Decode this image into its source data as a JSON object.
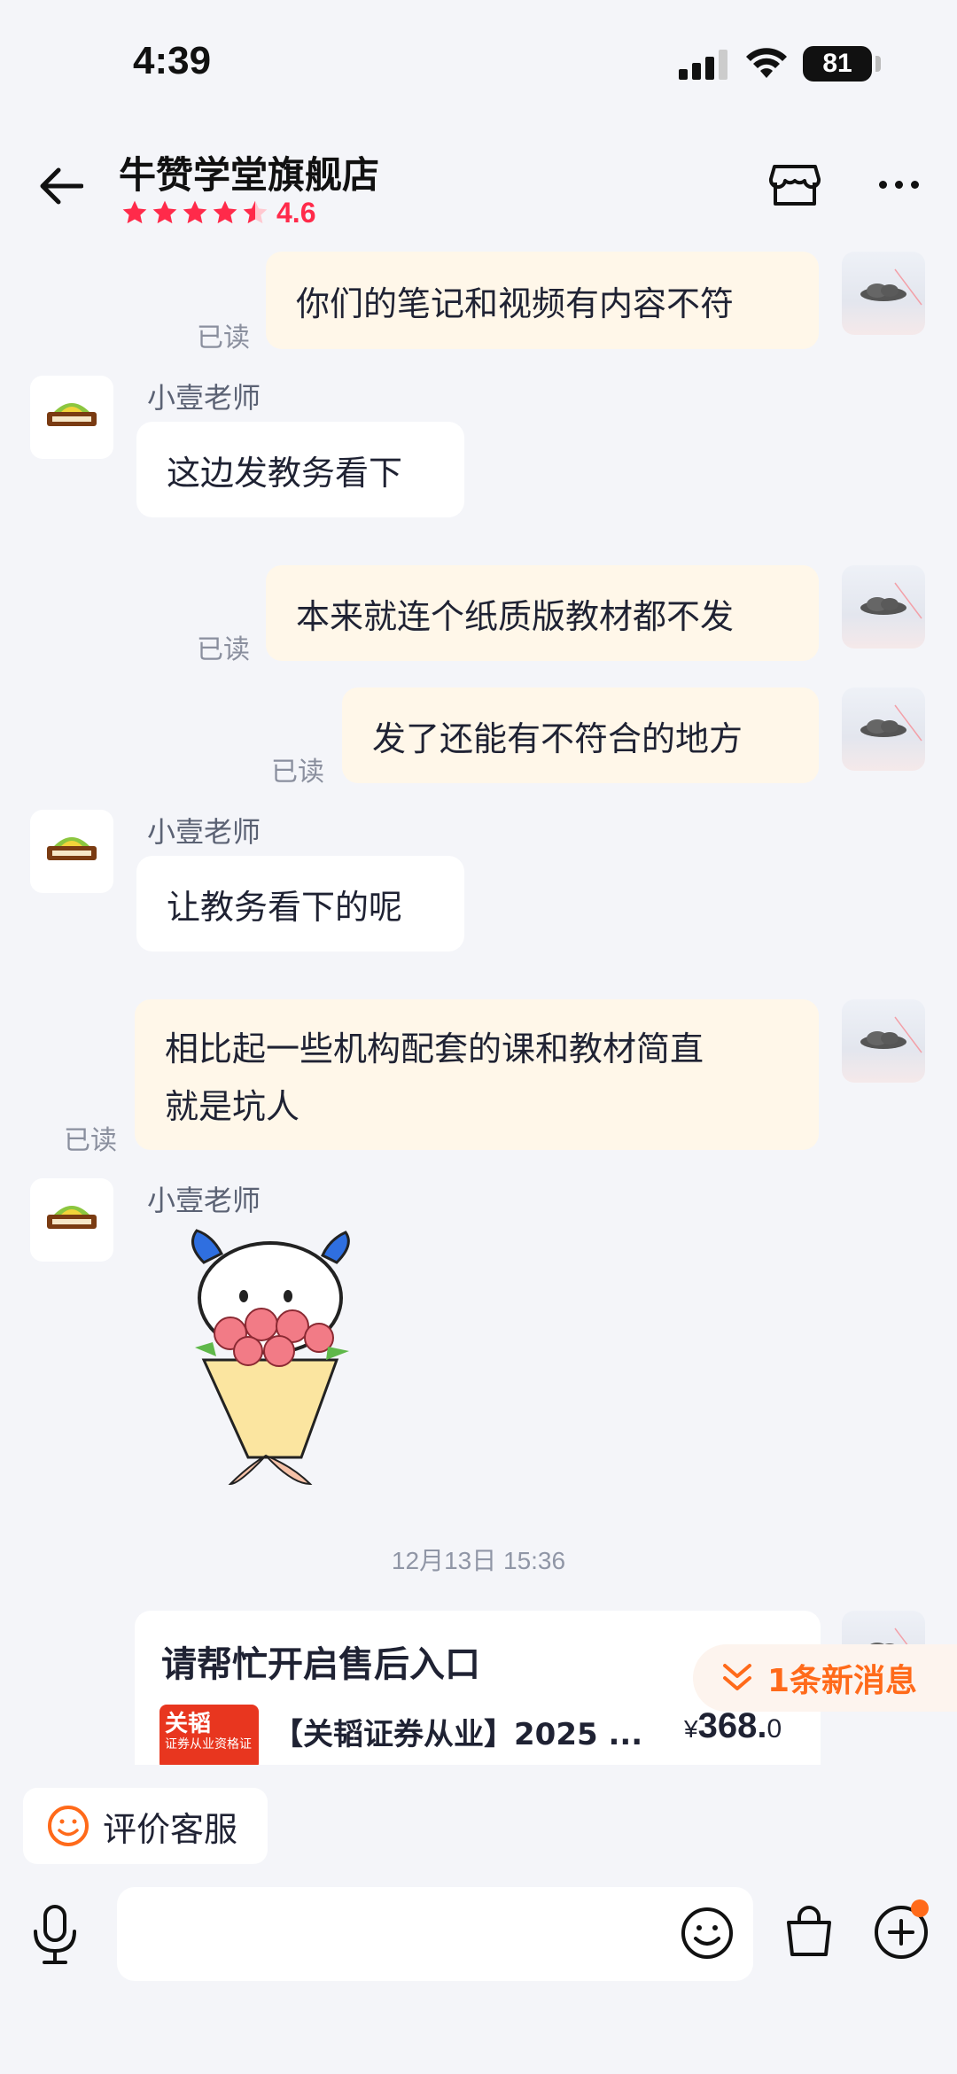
{
  "status_bar": {
    "time": "4:39",
    "battery": "81"
  },
  "header": {
    "shop_name": "牛赞学堂旗舰店",
    "rating": "4.6",
    "stars_filled": 4.5
  },
  "messages": [
    {
      "side": "right",
      "text": "你们的笔记和视频有内容不符",
      "read": "已读"
    },
    {
      "side": "left",
      "sender": "小壹老师",
      "text": "这边发教务看下"
    },
    {
      "side": "right",
      "text": "本来就连个纸质版教材都不发",
      "read": "已读"
    },
    {
      "side": "right",
      "text": "发了还能有不符合的地方",
      "read": "已读"
    },
    {
      "side": "left",
      "sender": "小壹老师",
      "text": "让教务看下的呢"
    },
    {
      "side": "right",
      "text_line1": "相比起一些机构配套的课和教材简直",
      "text_line2": "就是坑人",
      "read": "已读"
    },
    {
      "side": "left",
      "sender": "小壹老师",
      "sticker": "cow-holding-roses-sticker"
    }
  ],
  "timestamp": "12月13日 15:36",
  "card": {
    "title": "请帮忙开启售后入口",
    "thumb_title": "关韬",
    "thumb_subtitle": "证券从业资格证",
    "product_name": "【关韬证券从业】2025 ...",
    "price_currency": "¥",
    "price_int": "368.",
    "price_dec": "0"
  },
  "new_message_pill": "1条新消息",
  "rate_service": "评价客服",
  "input": {
    "placeholder": ""
  },
  "colors": {
    "accent": "#ff6a1a",
    "rating": "#ff2a4a",
    "bubble_mine": "#fff7e9",
    "bubble_other": "#ffffff",
    "background": "#f4f5f9"
  }
}
